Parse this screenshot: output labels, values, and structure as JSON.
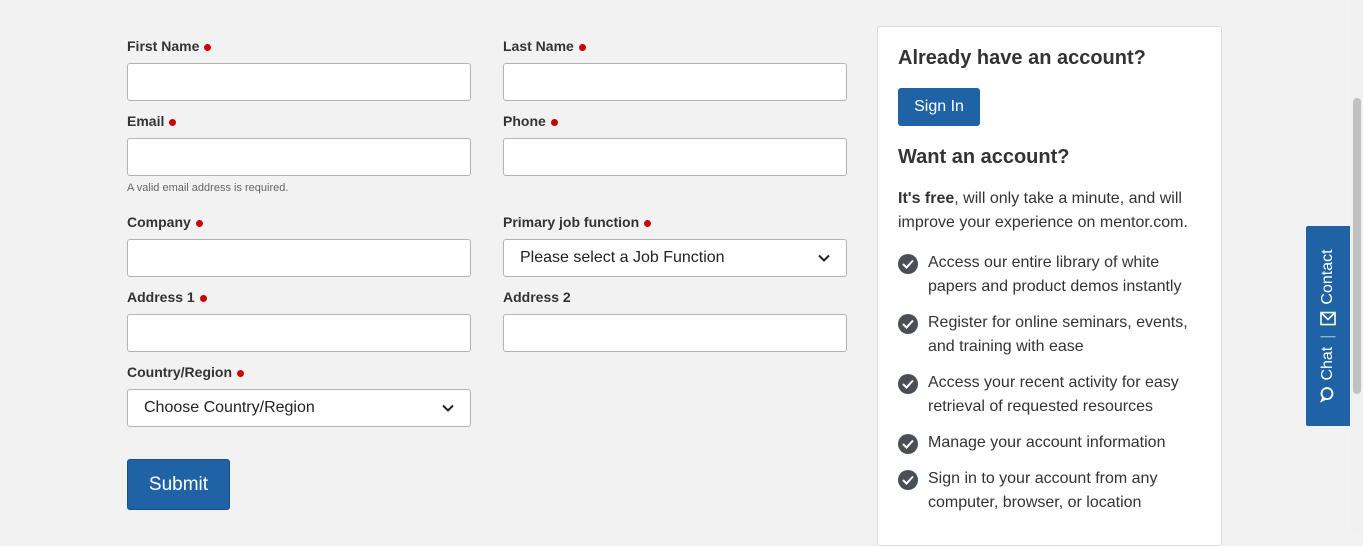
{
  "form": {
    "first_name_label": "First Name",
    "last_name_label": "Last Name",
    "email_label": "Email",
    "phone_label": "Phone",
    "email_hint": "A valid email address is required.",
    "company_label": "Company",
    "job_function_label": "Primary job function",
    "job_function_value": "Please select a Job Function",
    "address1_label": "Address 1",
    "address2_label": "Address 2",
    "country_label": "Country/Region",
    "country_value": "Choose Country/Region",
    "submit_label": "Submit"
  },
  "panel": {
    "heading_existing": "Already have an account?",
    "signin_label": "Sign In",
    "heading_new": "Want an account?",
    "intro_bold": "It's free",
    "intro_rest": ", will only take a minute, and will improve your experience on mentor.com.",
    "benefits": [
      "Access our entire library of white papers and product demos instantly",
      "Register for online seminars, events, and training with ease",
      "Access your recent activity for easy retrieval of requested resources",
      "Manage your account information",
      "Sign in to your account from any computer, browser, or location"
    ]
  },
  "side_tab": {
    "chat_label": "Chat",
    "contact_label": "Contact"
  },
  "colors": {
    "primary": "#1f63a6",
    "required": "#cc0000",
    "background": "#f2f2f2"
  },
  "icons": [
    "chevron-down-icon",
    "check-circle-icon",
    "chat-icon",
    "mail-icon"
  ]
}
